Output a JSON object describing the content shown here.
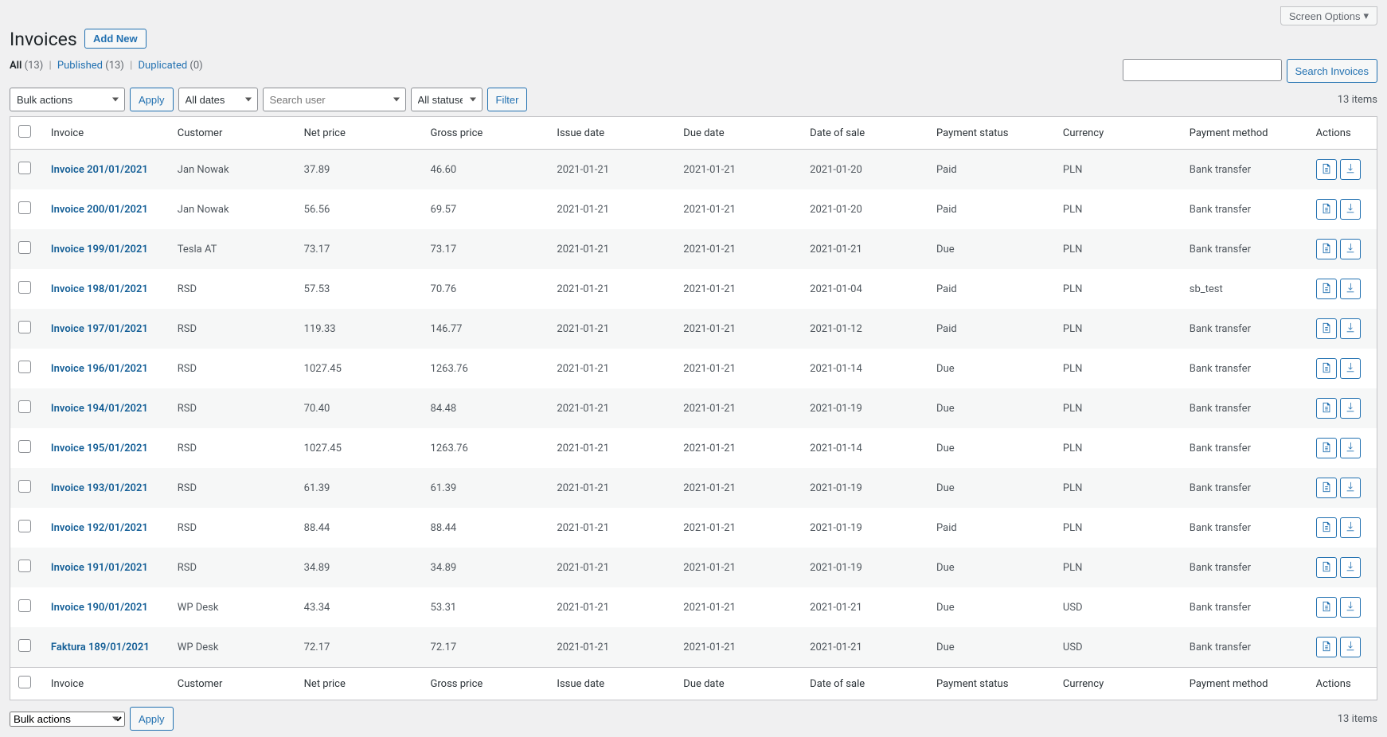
{
  "screenOptions": "Screen Options",
  "pageTitle": "Invoices",
  "addNew": "Add New",
  "filters": {
    "all_label": "All",
    "all_count": "(13)",
    "published_label": "Published",
    "published_count": "(13)",
    "duplicated_label": "Duplicated",
    "duplicated_count": "(0)"
  },
  "search": {
    "button": "Search Invoices",
    "value": ""
  },
  "nav": {
    "bulk": "Bulk actions",
    "apply": "Apply",
    "dates": "All dates",
    "userPlaceholder": "Search user",
    "statuses": "All statuses",
    "filter": "Filter",
    "count": "13 items"
  },
  "columns": {
    "invoice": "Invoice",
    "customer": "Customer",
    "net": "Net price",
    "gross": "Gross price",
    "issue": "Issue date",
    "due": "Due date",
    "sale": "Date of sale",
    "pstatus": "Payment status",
    "currency": "Currency",
    "pmethod": "Payment method",
    "actions": "Actions"
  },
  "rows": [
    {
      "invoice": "Invoice 201/01/2021",
      "customer": "Jan Nowak",
      "net": "37.89",
      "gross": "46.60",
      "issue": "2021-01-21",
      "due": "2021-01-21",
      "sale": "2021-01-20",
      "pstatus": "Paid",
      "currency": "PLN",
      "pmethod": "Bank transfer"
    },
    {
      "invoice": "Invoice 200/01/2021",
      "customer": "Jan Nowak",
      "net": "56.56",
      "gross": "69.57",
      "issue": "2021-01-21",
      "due": "2021-01-21",
      "sale": "2021-01-20",
      "pstatus": "Paid",
      "currency": "PLN",
      "pmethod": "Bank transfer"
    },
    {
      "invoice": "Invoice 199/01/2021",
      "customer": "Tesla AT",
      "net": "73.17",
      "gross": "73.17",
      "issue": "2021-01-21",
      "due": "2021-01-21",
      "sale": "2021-01-21",
      "pstatus": "Due",
      "currency": "PLN",
      "pmethod": "Bank transfer"
    },
    {
      "invoice": "Invoice 198/01/2021",
      "customer": "RSD",
      "net": "57.53",
      "gross": "70.76",
      "issue": "2021-01-21",
      "due": "2021-01-21",
      "sale": "2021-01-04",
      "pstatus": "Paid",
      "currency": "PLN",
      "pmethod": "sb_test"
    },
    {
      "invoice": "Invoice 197/01/2021",
      "customer": "RSD",
      "net": "119.33",
      "gross": "146.77",
      "issue": "2021-01-21",
      "due": "2021-01-21",
      "sale": "2021-01-12",
      "pstatus": "Paid",
      "currency": "PLN",
      "pmethod": "Bank transfer"
    },
    {
      "invoice": "Invoice 196/01/2021",
      "customer": "RSD",
      "net": "1027.45",
      "gross": "1263.76",
      "issue": "2021-01-21",
      "due": "2021-01-21",
      "sale": "2021-01-14",
      "pstatus": "Due",
      "currency": "PLN",
      "pmethod": "Bank transfer"
    },
    {
      "invoice": "Invoice 194/01/2021",
      "customer": "RSD",
      "net": "70.40",
      "gross": "84.48",
      "issue": "2021-01-21",
      "due": "2021-01-21",
      "sale": "2021-01-19",
      "pstatus": "Due",
      "currency": "PLN",
      "pmethod": "Bank transfer"
    },
    {
      "invoice": "Invoice 195/01/2021",
      "customer": "RSD",
      "net": "1027.45",
      "gross": "1263.76",
      "issue": "2021-01-21",
      "due": "2021-01-21",
      "sale": "2021-01-14",
      "pstatus": "Due",
      "currency": "PLN",
      "pmethod": "Bank transfer"
    },
    {
      "invoice": "Invoice 193/01/2021",
      "customer": "RSD",
      "net": "61.39",
      "gross": "61.39",
      "issue": "2021-01-21",
      "due": "2021-01-21",
      "sale": "2021-01-19",
      "pstatus": "Due",
      "currency": "PLN",
      "pmethod": "Bank transfer"
    },
    {
      "invoice": "Invoice 192/01/2021",
      "customer": "RSD",
      "net": "88.44",
      "gross": "88.44",
      "issue": "2021-01-21",
      "due": "2021-01-21",
      "sale": "2021-01-19",
      "pstatus": "Paid",
      "currency": "PLN",
      "pmethod": "Bank transfer"
    },
    {
      "invoice": "Invoice 191/01/2021",
      "customer": "RSD",
      "net": "34.89",
      "gross": "34.89",
      "issue": "2021-01-21",
      "due": "2021-01-21",
      "sale": "2021-01-19",
      "pstatus": "Due",
      "currency": "PLN",
      "pmethod": "Bank transfer"
    },
    {
      "invoice": "Invoice 190/01/2021",
      "customer": "WP Desk",
      "net": "43.34",
      "gross": "53.31",
      "issue": "2021-01-21",
      "due": "2021-01-21",
      "sale": "2021-01-21",
      "pstatus": "Due",
      "currency": "USD",
      "pmethod": "Bank transfer"
    },
    {
      "invoice": "Faktura 189/01/2021",
      "customer": "WP Desk",
      "net": "72.17",
      "gross": "72.17",
      "issue": "2021-01-21",
      "due": "2021-01-21",
      "sale": "2021-01-21",
      "pstatus": "Due",
      "currency": "USD",
      "pmethod": "Bank transfer"
    }
  ]
}
